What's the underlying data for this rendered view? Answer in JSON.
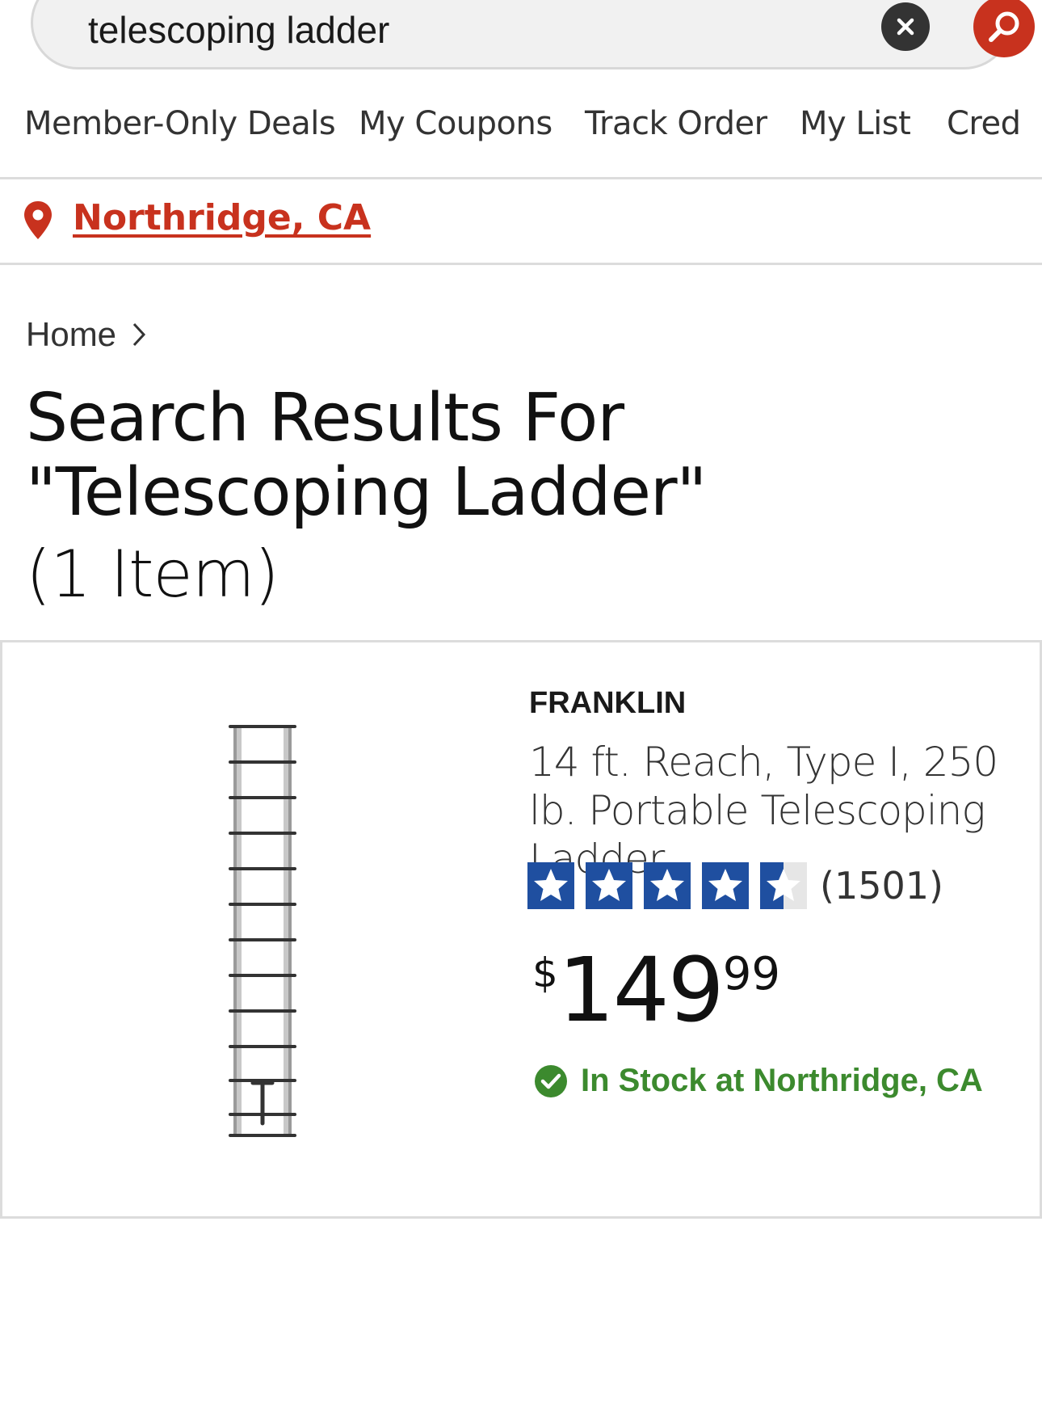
{
  "search": {
    "query": "telescoping ladder"
  },
  "nav": {
    "items": [
      "Member-Only Deals",
      "My Coupons",
      "Track Order",
      "My List",
      "Cred"
    ]
  },
  "location": {
    "label": "Northridge, CA"
  },
  "breadcrumb": {
    "home": "Home"
  },
  "results": {
    "title": "Search Results For \"Telescoping Ladder\"",
    "count": "(1 Item)"
  },
  "product": {
    "brand": "FRANKLIN",
    "name": "14 ft. Reach, Type I, 250 lb. Portable Telescoping Ladder",
    "rating": 4.5,
    "review_count": "(1501)",
    "price_symbol": "$",
    "price_whole": "149",
    "price_cents": "99",
    "stock": "In Stock at Northridge, CA"
  },
  "colors": {
    "accent": "#c8321e",
    "star": "#1f4fa0",
    "in_stock": "#3c8a2e"
  }
}
